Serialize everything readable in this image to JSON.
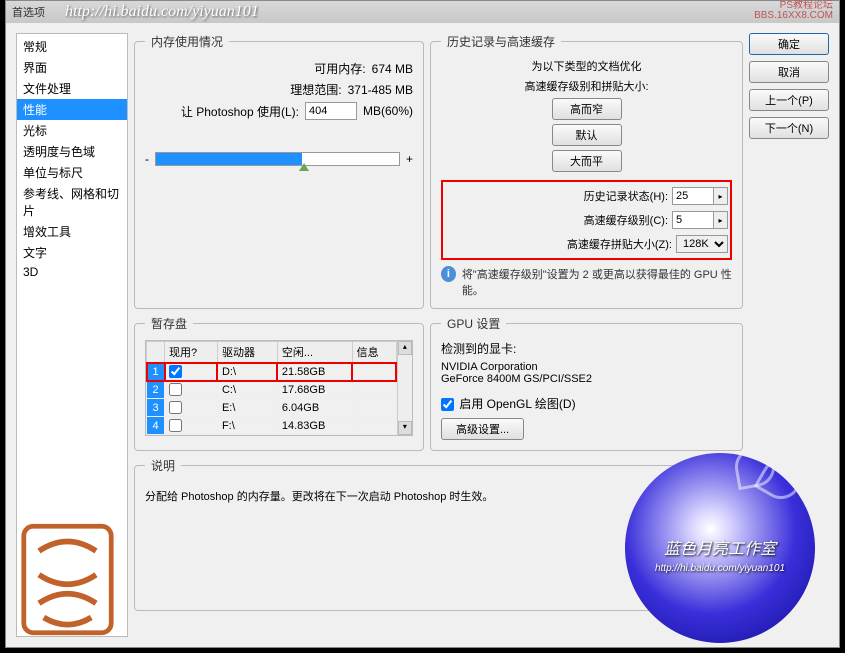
{
  "titlebar": {
    "title": "首选项",
    "url": "http://hi.baidu.com/yiyuan101",
    "wm1": "PS教程论坛",
    "wm2": "BBS.16XX8.COM"
  },
  "sidebar": {
    "items": [
      "常规",
      "界面",
      "文件处理",
      "性能",
      "光标",
      "透明度与色域",
      "单位与标尺",
      "参考线、网格和切片",
      "增效工具",
      "文字",
      "3D"
    ],
    "selected_index": 3
  },
  "memory": {
    "legend": "内存使用情况",
    "avail_label": "可用内存:",
    "avail_value": "674 MB",
    "ideal_label": "理想范围:",
    "ideal_value": "371-485 MB",
    "let_label": "让 Photoshop 使用(L):",
    "let_value": "404",
    "let_suffix": "MB(60%)",
    "minus": "-",
    "plus": "+"
  },
  "history": {
    "legend": "历史记录与高速缓存",
    "opt_line1": "为以下类型的文档优化",
    "opt_line2": "高速缓存级别和拼贴大小:",
    "btn_tall": "高而窄",
    "btn_default": "默认",
    "btn_wide": "大而平",
    "states_label": "历史记录状态(H):",
    "states_value": "25",
    "cache_label": "高速缓存级别(C):",
    "cache_value": "5",
    "tile_label": "高速缓存拼贴大小(Z):",
    "tile_value": "128K",
    "info_text": "将\"高速缓存级别\"设置为 2 或更高以获得最佳的 GPU 性能。"
  },
  "scratch": {
    "legend": "暂存盘",
    "headers": [
      "",
      "现用?",
      "驱动器",
      "空闲...",
      "信息"
    ],
    "rows": [
      {
        "n": "1",
        "active": true,
        "drive": "D:\\",
        "free": "21.58GB",
        "info": ""
      },
      {
        "n": "2",
        "active": false,
        "drive": "C:\\",
        "free": "17.68GB",
        "info": ""
      },
      {
        "n": "3",
        "active": false,
        "drive": "E:\\",
        "free": "6.04GB",
        "info": ""
      },
      {
        "n": "4",
        "active": false,
        "drive": "F:\\",
        "free": "14.83GB",
        "info": ""
      }
    ]
  },
  "gpu": {
    "legend": "GPU 设置",
    "detected_label": "检测到的显卡:",
    "vendor": "NVIDIA Corporation",
    "model": "GeForce 8400M GS/PCI/SSE2",
    "enable_label": "启用 OpenGL 绘图(D)",
    "advanced_btn": "高级设置..."
  },
  "desc": {
    "legend": "说明",
    "text": "分配给 Photoshop 的内存量。更改将在下一次启动 Photoshop 时生效。"
  },
  "actions": {
    "ok": "确定",
    "cancel": "取消",
    "prev": "上一个(P)",
    "next": "下一个(N)"
  },
  "badge": {
    "text1": "蓝色月亮工作室",
    "text2": "http://hi.baidu.com/yiyuan101"
  }
}
